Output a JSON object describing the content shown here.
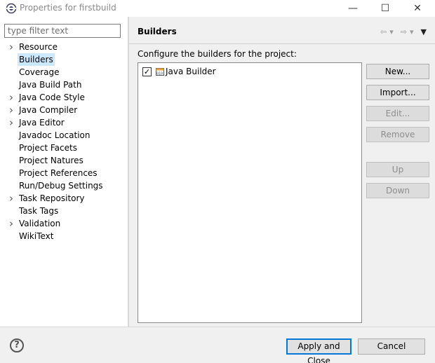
{
  "window": {
    "title": "Properties for firstbuild",
    "min_glyph": "—",
    "max_glyph": "☐",
    "close_glyph": "✕"
  },
  "sidebar": {
    "filter_placeholder": "type filter text",
    "items": [
      {
        "label": "Resource",
        "expandable": true,
        "selected": false
      },
      {
        "label": "Builders",
        "expandable": false,
        "selected": true
      },
      {
        "label": "Coverage",
        "expandable": false,
        "selected": false
      },
      {
        "label": "Java Build Path",
        "expandable": false,
        "selected": false
      },
      {
        "label": "Java Code Style",
        "expandable": true,
        "selected": false
      },
      {
        "label": "Java Compiler",
        "expandable": true,
        "selected": false
      },
      {
        "label": "Java Editor",
        "expandable": true,
        "selected": false
      },
      {
        "label": "Javadoc Location",
        "expandable": false,
        "selected": false
      },
      {
        "label": "Project Facets",
        "expandable": false,
        "selected": false
      },
      {
        "label": "Project Natures",
        "expandable": false,
        "selected": false
      },
      {
        "label": "Project References",
        "expandable": false,
        "selected": false
      },
      {
        "label": "Run/Debug Settings",
        "expandable": false,
        "selected": false
      },
      {
        "label": "Task Repository",
        "expandable": true,
        "selected": false
      },
      {
        "label": "Task Tags",
        "expandable": false,
        "selected": false
      },
      {
        "label": "Validation",
        "expandable": true,
        "selected": false
      },
      {
        "label": "WikiText",
        "expandable": false,
        "selected": false
      }
    ]
  },
  "main": {
    "title": "Builders",
    "description": "Configure the builders for the project:",
    "builders": [
      {
        "name": "Java Builder",
        "checked": true,
        "icon": "java-builder-icon"
      }
    ],
    "buttons": {
      "new": "New...",
      "import": "Import...",
      "edit": "Edit...",
      "remove": "Remove",
      "up": "Up",
      "down": "Down"
    }
  },
  "footer": {
    "help_glyph": "?",
    "apply_close": "Apply and Close",
    "cancel": "Cancel"
  },
  "colors": {
    "selection": "#cce8ff",
    "default_button_border": "#0078d7"
  }
}
